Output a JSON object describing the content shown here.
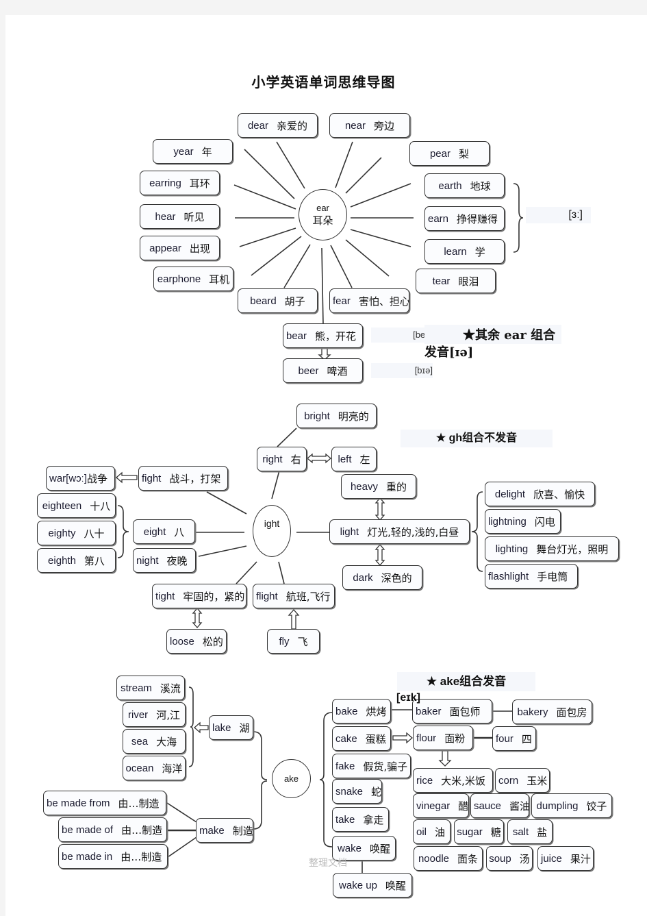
{
  "title": "小学英语单词思维导图",
  "ear_section": {
    "center": {
      "en": "ear",
      "zh": "耳朵"
    },
    "words": [
      {
        "id": "dear",
        "en": "dear",
        "zh": "亲爱的"
      },
      {
        "id": "near",
        "en": "near",
        "zh": "旁边"
      },
      {
        "id": "year",
        "en": "year",
        "zh": "年"
      },
      {
        "id": "pear",
        "en": "pear",
        "zh": "梨"
      },
      {
        "id": "earring",
        "en": "earring",
        "zh": "耳环"
      },
      {
        "id": "earth",
        "en": "earth",
        "zh": "地球"
      },
      {
        "id": "hear",
        "en": "hear",
        "zh": "听见"
      },
      {
        "id": "earn",
        "en": "earn",
        "zh": "挣得赚得"
      },
      {
        "id": "appear",
        "en": "appear",
        "zh": "出现"
      },
      {
        "id": "learn",
        "en": "learn",
        "zh": "学"
      },
      {
        "id": "earphone",
        "en": "earphone",
        "zh": "耳机"
      },
      {
        "id": "tear",
        "en": "tear",
        "zh": "眼泪"
      },
      {
        "id": "beard",
        "en": "beard",
        "zh": "胡子"
      },
      {
        "id": "fear",
        "en": "fear",
        "zh": "害怕、担心"
      },
      {
        "id": "bear",
        "en": "bear",
        "zh": "熊，开花"
      },
      {
        "id": "beer",
        "en": "beer",
        "zh": "啤酒"
      }
    ],
    "phonetic_er": "[ɜː]",
    "phonetic_bear": "[beə]",
    "phonetic_beer": "[bɪə]",
    "note_line1": "★其余 ear 组合",
    "note_line2": "发音[ɪə]"
  },
  "ight_section": {
    "center": "ight",
    "note": "★  gh组合不发音",
    "words": [
      {
        "id": "bright",
        "en": "bright",
        "zh": "明亮的"
      },
      {
        "id": "right",
        "en": "right",
        "zh": "右"
      },
      {
        "id": "left",
        "en": "left",
        "zh": "左"
      },
      {
        "id": "war",
        "en": "war[wɔː]",
        "zh": "战争"
      },
      {
        "id": "fight",
        "en": "fight",
        "zh": "战斗，打架"
      },
      {
        "id": "heavy",
        "en": "heavy",
        "zh": "重的"
      },
      {
        "id": "eighteen",
        "en": "eighteen",
        "zh": "十八"
      },
      {
        "id": "eighty",
        "en": "eighty",
        "zh": "八十"
      },
      {
        "id": "eighth",
        "en": "eighth",
        "zh": "第八"
      },
      {
        "id": "eight",
        "en": "eight",
        "zh": "八"
      },
      {
        "id": "night",
        "en": "night",
        "zh": "夜晚"
      },
      {
        "id": "light",
        "en": "light",
        "zh": "灯光,轻的,浅的,白昼"
      },
      {
        "id": "dark",
        "en": "dark",
        "zh": "深色的"
      },
      {
        "id": "delight",
        "en": "delight",
        "zh": "欣喜、愉快"
      },
      {
        "id": "lightning",
        "en": "lightning",
        "zh": "闪电"
      },
      {
        "id": "lighting",
        "en": "lighting",
        "zh": "舞台灯光，照明"
      },
      {
        "id": "flashlight",
        "en": "flashlight",
        "zh": "手电筒"
      },
      {
        "id": "tight",
        "en": "tight",
        "zh": "牢固的，紧的"
      },
      {
        "id": "flight",
        "en": "flight",
        "zh": "航班,飞行"
      },
      {
        "id": "loose",
        "en": "loose",
        "zh": "松的"
      },
      {
        "id": "fly",
        "en": "fly",
        "zh": "飞"
      }
    ]
  },
  "ake_section": {
    "center": "ake",
    "note": "★  ake组合发音",
    "phonetic": "[eɪk]",
    "words": [
      {
        "id": "stream",
        "en": "stream",
        "zh": "溪流"
      },
      {
        "id": "river",
        "en": "river",
        "zh": "河,江"
      },
      {
        "id": "sea",
        "en": "sea",
        "zh": "大海"
      },
      {
        "id": "ocean",
        "en": "ocean",
        "zh": "海洋"
      },
      {
        "id": "lake",
        "en": "lake",
        "zh": "湖"
      },
      {
        "id": "be_made_from",
        "en": "be  made  from",
        "zh": "由…制造"
      },
      {
        "id": "be_made_of",
        "en": "be  made  of",
        "zh": "由…制造"
      },
      {
        "id": "be_made_in",
        "en": "be  made  in",
        "zh": "由…制造"
      },
      {
        "id": "make",
        "en": "make",
        "zh": "制造"
      },
      {
        "id": "bake",
        "en": "bake",
        "zh": "烘烤"
      },
      {
        "id": "cake",
        "en": "cake",
        "zh": "蛋糕"
      },
      {
        "id": "fake",
        "en": "fake",
        "zh": "假货,骗子"
      },
      {
        "id": "snake",
        "en": "snake",
        "zh": "蛇"
      },
      {
        "id": "take",
        "en": "take",
        "zh": "拿走"
      },
      {
        "id": "wake",
        "en": "wake",
        "zh": "唤醒"
      },
      {
        "id": "wake_up",
        "en": "wake  up",
        "zh": "唤醒"
      },
      {
        "id": "baker",
        "en": "baker",
        "zh": "面包师"
      },
      {
        "id": "bakery",
        "en": "bakery",
        "zh": "面包房"
      },
      {
        "id": "flour",
        "en": "flour",
        "zh": "面粉"
      },
      {
        "id": "four",
        "en": "four",
        "zh": "四"
      },
      {
        "id": "rice",
        "en": "rice",
        "zh": "大米,米饭"
      },
      {
        "id": "corn",
        "en": "corn",
        "zh": "玉米"
      },
      {
        "id": "vinegar",
        "en": "vinegar",
        "zh": "醋"
      },
      {
        "id": "sauce",
        "en": "sauce",
        "zh": "酱油"
      },
      {
        "id": "dumpling",
        "en": "dumpling",
        "zh": "饺子"
      },
      {
        "id": "oil",
        "en": "oil",
        "zh": "油"
      },
      {
        "id": "sugar",
        "en": "sugar",
        "zh": "糖"
      },
      {
        "id": "salt",
        "en": "salt",
        "zh": "盐"
      },
      {
        "id": "noodle",
        "en": "noodle",
        "zh": "面条"
      },
      {
        "id": "soup",
        "en": "soup",
        "zh": "汤"
      },
      {
        "id": "juice",
        "en": "juice",
        "zh": "果汁"
      }
    ]
  },
  "watermark": "整理文档"
}
